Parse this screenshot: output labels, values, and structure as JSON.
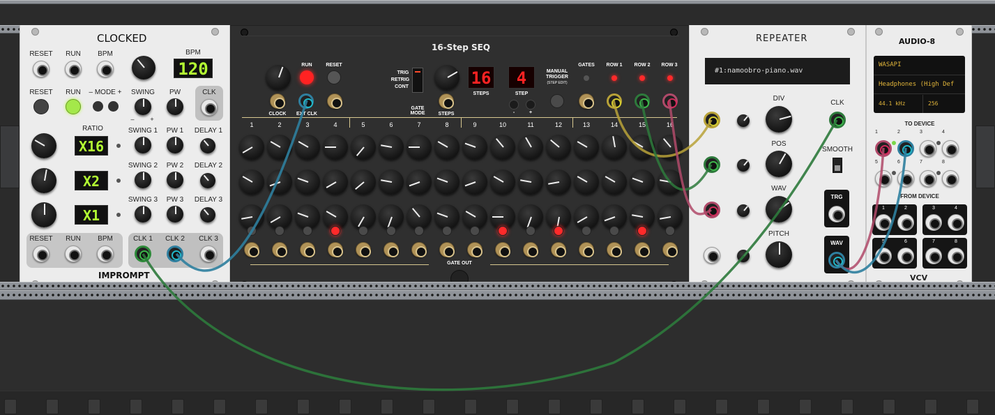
{
  "clocked": {
    "title": "CLOCKED",
    "brand": "IMPROMPT",
    "top_labels": [
      "RESET",
      "RUN",
      "BPM"
    ],
    "bpm_label": "BPM",
    "bpm_value": "120",
    "row2_labels": [
      "RESET",
      "RUN"
    ],
    "mode_label": "– MODE +",
    "swing_label": "SWING",
    "pw_label": "PW",
    "clk_label": "CLK",
    "ratio_label": "RATIO",
    "ratios": [
      "X16",
      "X2",
      "X1"
    ],
    "swing_labels": [
      "SWING 1",
      "SWING 2",
      "SWING 3"
    ],
    "pw_labels": [
      "PW 1",
      "PW 2",
      "PW 3"
    ],
    "delay_labels": [
      "DELAY 1",
      "DELAY 2",
      "DELAY 3"
    ],
    "bottom_labels": [
      "RESET",
      "RUN",
      "BPM"
    ],
    "clk_out_labels": [
      "CLK 1",
      "CLK 2",
      "CLK 3"
    ],
    "pm_minus": "–",
    "pm_plus": "+"
  },
  "seq": {
    "title": "16-Step SEQ",
    "run_label": "RUN",
    "reset_label": "RESET",
    "clock_label": "CLOCK",
    "ext_clk_label": "EXT CLK",
    "gate_modes": [
      "TRIG",
      "RETRIG",
      "CONT"
    ],
    "gate_mode_label": "GATE\nMODE",
    "steps_label": "STEPS",
    "steps_value": "16",
    "step_label": "STEP",
    "step_value": "4",
    "step_minus": "-",
    "step_plus": "+",
    "manual_trigger_label": "MANUAL\nTRIGGER",
    "step_edit_label": "(STEP EDIT)",
    "out_labels": [
      "GATES",
      "ROW 1",
      "ROW 2",
      "ROW 3"
    ],
    "step_numbers": [
      "1",
      "2",
      "3",
      "4",
      "5",
      "6",
      "7",
      "8",
      "9",
      "10",
      "11",
      "12",
      "13",
      "14",
      "15",
      "16"
    ],
    "gate_out_label": "GATE OUT",
    "gate_leds_on": [
      4,
      10,
      12,
      15
    ],
    "knob_rows": [
      [
        -120,
        -60,
        -60,
        -90,
        -140,
        -80,
        -90,
        -60,
        -70,
        -40,
        -30,
        -50,
        -60,
        -10,
        -60,
        -40
      ],
      [
        -60,
        -110,
        -70,
        -120,
        -130,
        -80,
        -110,
        -70,
        -110,
        -60,
        -80,
        -100,
        -60,
        -60,
        -70,
        -80
      ],
      [
        -100,
        -120,
        -70,
        -60,
        -150,
        -160,
        -40,
        -70,
        -60,
        -90,
        -160,
        -170,
        -120,
        -110,
        -80,
        -100
      ]
    ]
  },
  "repeater": {
    "title": "REPEATER",
    "file": "#1:namoobro-piano.wav",
    "clk_label": "CLK",
    "div_label": "DIV",
    "pos_label": "POS",
    "wav_label": "WAV",
    "pitch_label": "PITCH",
    "smooth_label": "SMOOTH",
    "trg_label": "TRG",
    "wav_out_label": "WAV"
  },
  "audio": {
    "title": "AUDIO-8",
    "driver": "WASAPI",
    "device": "Headphones (High Def",
    "sample_rate": "44.1 kHz",
    "block_size": "256",
    "to_device_label": "TO DEVICE",
    "from_device_label": "FROM DEVICE",
    "port_numbers": [
      "1",
      "2",
      "3",
      "4",
      "5",
      "6",
      "7",
      "8"
    ],
    "brand": "VCV"
  },
  "colors": {
    "cable_blue": "#2f7f9f",
    "cable_green": "#2e7a3c",
    "cable_yellow": "#b8a238",
    "cable_pink": "#b04a6a",
    "led_red": "#ff2a2a",
    "display_green": "#b3ff33"
  }
}
